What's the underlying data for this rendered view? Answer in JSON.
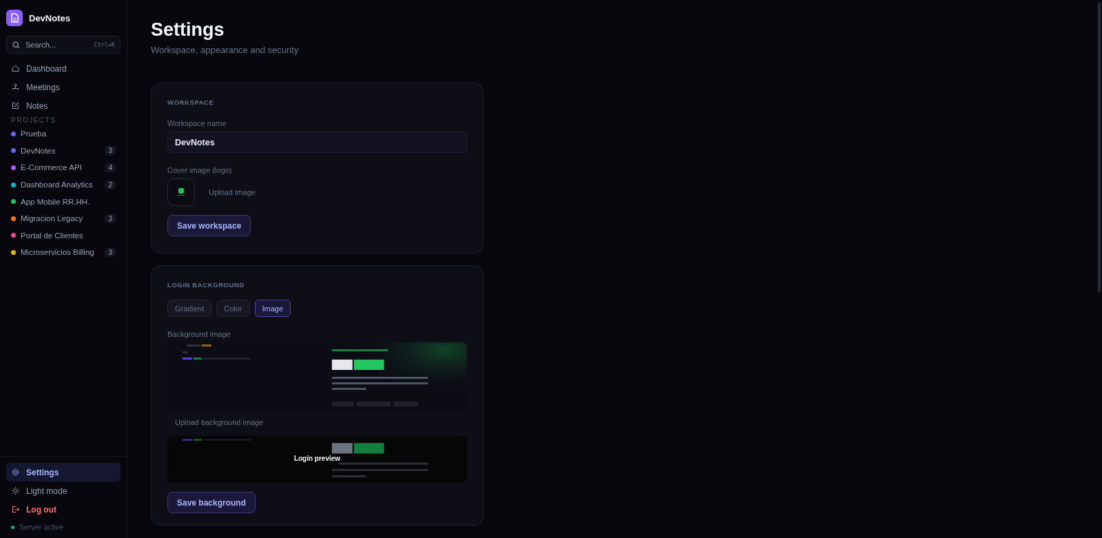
{
  "sidebar": {
    "app_name": "DevNotes",
    "search": {
      "placeholder": "Search...",
      "shortcut": "Ctrl+K"
    },
    "nav": [
      {
        "label": "Dashboard",
        "kind": "home",
        "selected": false
      },
      {
        "label": "Meetings",
        "kind": "people",
        "selected": false
      },
      {
        "label": "Notes",
        "kind": "edit",
        "selected": false
      }
    ],
    "projects_heading": "PROJECTS",
    "projects": [
      {
        "name": "Prueba",
        "color": "#6366f1"
      },
      {
        "name": "DevNotes",
        "color": "#6366f1",
        "count": "3"
      },
      {
        "name": "E-Commerce API",
        "color": "#a855f7",
        "count": "4"
      },
      {
        "name": "Dashboard Analytics",
        "color": "#06b6d4",
        "count": "2"
      },
      {
        "name": "App Mobile RR.HH.",
        "color": "#22c55e"
      },
      {
        "name": "Migracion Legacy",
        "color": "#f97316",
        "count": "3"
      },
      {
        "name": "Portal de Clientes",
        "color": "#ec4899"
      },
      {
        "name": "Microservicios Billing",
        "color": "#eab308",
        "count": "3"
      }
    ],
    "bottom": [
      {
        "label": "Settings",
        "kind": "gear",
        "selected": true
      },
      {
        "label": "Light mode",
        "kind": "sun",
        "selected": false
      },
      {
        "label": "Log out",
        "kind": "logout",
        "selected": false
      }
    ],
    "status": {
      "label": "Server active",
      "color": "#10b981"
    }
  },
  "page": {
    "title": "Settings",
    "subtitle": "Workspace, appearance and security"
  },
  "workspace": {
    "heading": "WORKSPACE",
    "name_label": "Workspace name",
    "name_value": "DevNotes",
    "cover_label": "Cover image (logo)",
    "upload": "Upload image",
    "save": "Save workspace"
  },
  "login_background": {
    "heading": "LOGIN BACKGROUND",
    "tabs": [
      {
        "label": "Gradient",
        "selected": false
      },
      {
        "label": "Color",
        "selected": false
      },
      {
        "label": "Image",
        "selected": true
      }
    ],
    "image_label": "Background image",
    "upload_label": "Upload background image",
    "preview": {
      "kind": "picture",
      "label": "Login preview"
    },
    "save": "Save background"
  }
}
